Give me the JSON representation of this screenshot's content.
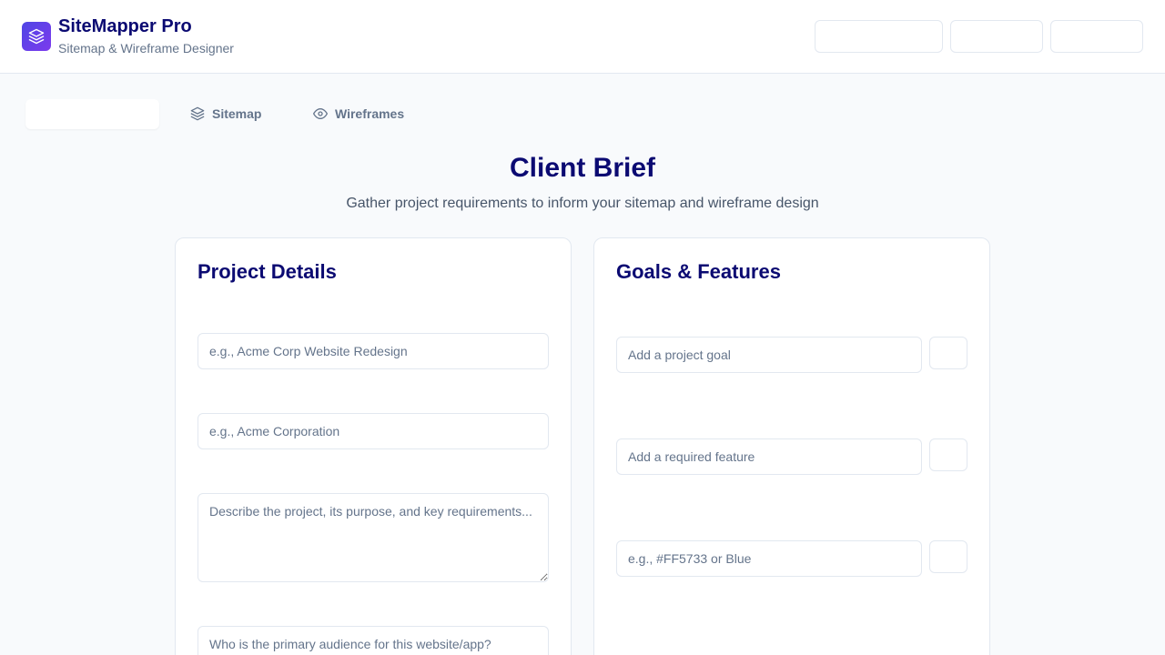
{
  "header": {
    "title": "SiteMapper Pro",
    "subtitle": "Sitemap & Wireframe Designer",
    "logo_icon": "layers-icon",
    "brand_color": "#0b0a72",
    "logo_gradient": [
      "#4f46e5",
      "#7c3aed"
    ]
  },
  "tabs": [
    {
      "label": "",
      "icon": "",
      "active": true
    },
    {
      "label": "Sitemap",
      "icon": "layers-icon",
      "active": false
    },
    {
      "label": "Wireframes",
      "icon": "eye-icon",
      "active": false
    }
  ],
  "main": {
    "title": "Client Brief",
    "subtitle": "Gather project requirements to inform your sitemap and wireframe design"
  },
  "project_details": {
    "title": "Project Details",
    "project_name_placeholder": "e.g., Acme Corp Website Redesign",
    "client_name_placeholder": "e.g., Acme Corporation",
    "description_placeholder": "Describe the project, its purpose, and key requirements...",
    "audience_placeholder": "Who is the primary audience for this website/app?"
  },
  "goals_features": {
    "title": "Goals & Features",
    "goal_placeholder": "Add a project goal",
    "feature_placeholder": "Add a required feature",
    "color_placeholder": "e.g., #FF5733 or Blue"
  }
}
